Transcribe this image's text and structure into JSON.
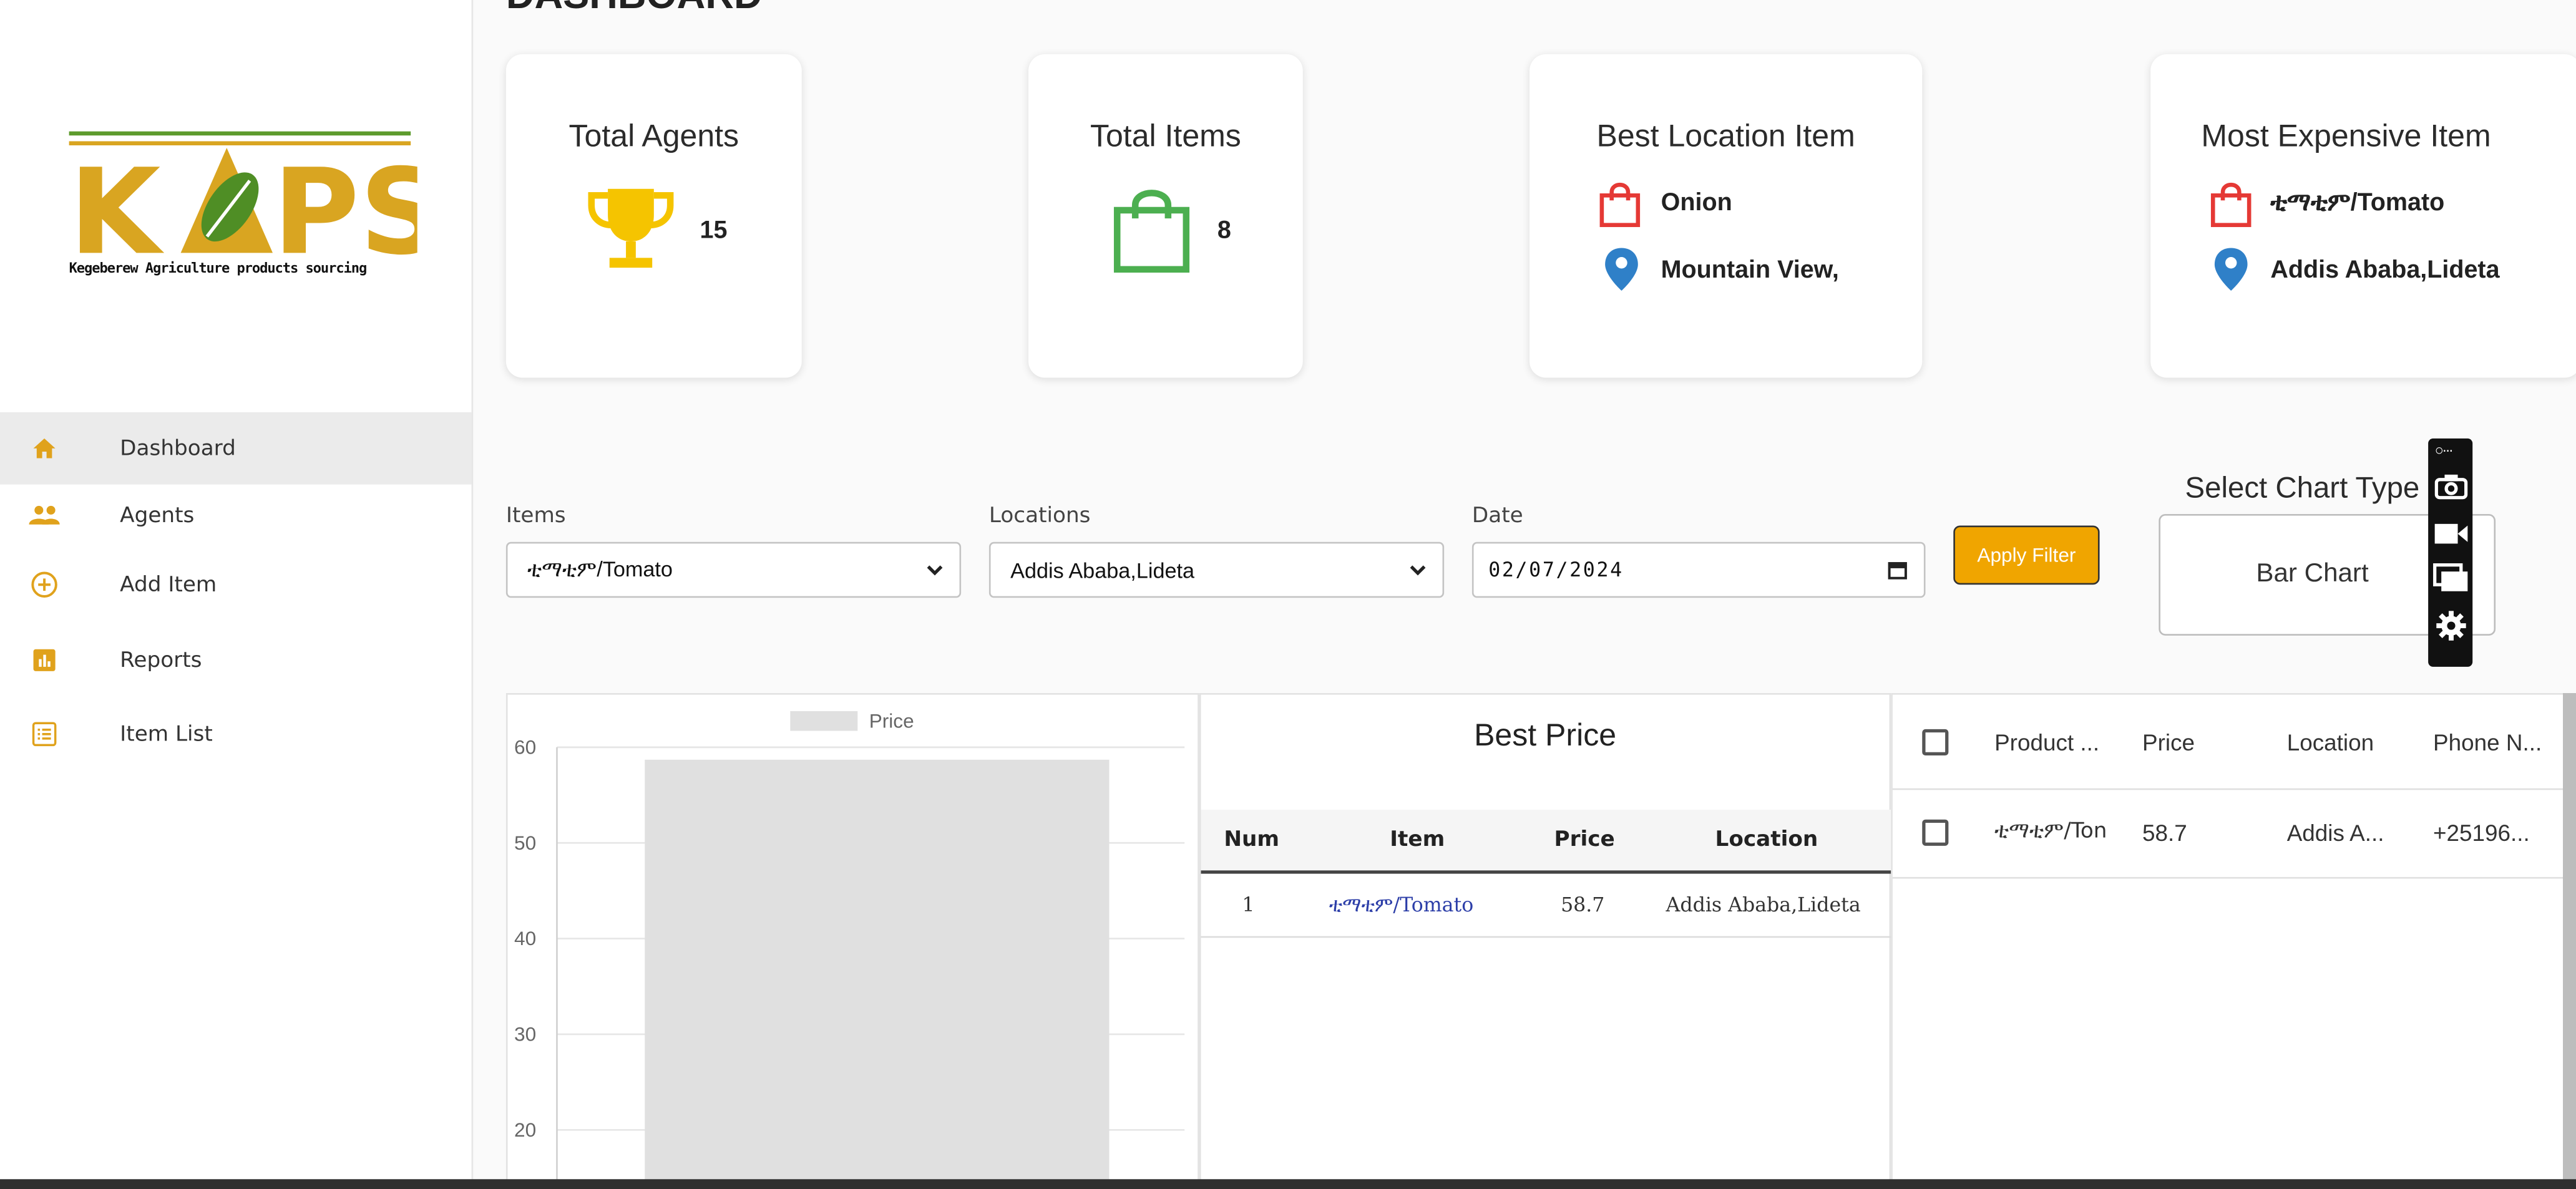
{
  "page": {
    "heading": "DASHBOARD"
  },
  "brand": {
    "logo_text": "KAPS",
    "tagline": "Kegeberew Agriculture products sourcing"
  },
  "sidebar": {
    "items": [
      {
        "label": "Dashboard",
        "icon": "home-icon",
        "active": true
      },
      {
        "label": "Agents",
        "icon": "people-icon",
        "active": false
      },
      {
        "label": "Add Item",
        "icon": "add-circle-icon",
        "active": false
      },
      {
        "label": "Reports",
        "icon": "bar-report-icon",
        "active": false
      },
      {
        "label": "Item List",
        "icon": "list-icon",
        "active": false
      }
    ]
  },
  "cards": {
    "total_agents": {
      "title": "Total Agents",
      "value": "15",
      "icon": "trophy-icon"
    },
    "total_items": {
      "title": "Total Items",
      "value": "8",
      "icon": "shopping-bag-icon"
    },
    "best_location": {
      "title": "Best Location Item",
      "item": "Onion",
      "location": "Mountain View,"
    },
    "most_expensive": {
      "title": "Most Expensive Item",
      "item": "ቲማቲም/Tomato",
      "location": "Addis Ababa,Lideta"
    }
  },
  "filters": {
    "items_label": "Items",
    "items_value": "ቲማቲም/Tomato",
    "locations_label": "Locations",
    "locations_value": "Addis Ababa,Lideta",
    "date_label": "Date",
    "date_value": "02/07/2024",
    "apply_label": "Apply Filter",
    "chart_type_label": "Select Chart Type",
    "chart_type_value": "Bar Chart"
  },
  "chart_data": {
    "type": "bar",
    "categories": [
      ""
    ],
    "series": [
      {
        "name": "Price",
        "values": [
          58.7
        ]
      }
    ],
    "ylim": [
      0,
      60
    ],
    "yticks": [
      20,
      30,
      40,
      50,
      60
    ],
    "legend": "top",
    "grid": true,
    "color": "#e0e0e0"
  },
  "best_price": {
    "title": "Best Price",
    "columns": [
      "Num",
      "Item",
      "Price",
      "Location"
    ],
    "rows": [
      {
        "num": "1",
        "item": "ቲማቲም/Tomato",
        "price": "58.7",
        "location": "Addis Ababa,Lideta"
      }
    ]
  },
  "data_grid": {
    "columns": [
      "Product ...",
      "Price",
      "Location",
      "Phone N..."
    ],
    "rows": [
      {
        "product": "ቲማቲም/Ton",
        "price": "58.7",
        "location": "Addis A...",
        "phone": "+25196..."
      }
    ]
  },
  "colors": {
    "accent": "#f0a500",
    "trophy": "#f5c400",
    "bag_green": "#4caf50",
    "bag_red": "#e53935",
    "pin_blue": "#2f80c8",
    "logo_gold": "#d9a521",
    "logo_green": "#5d9b2d"
  }
}
